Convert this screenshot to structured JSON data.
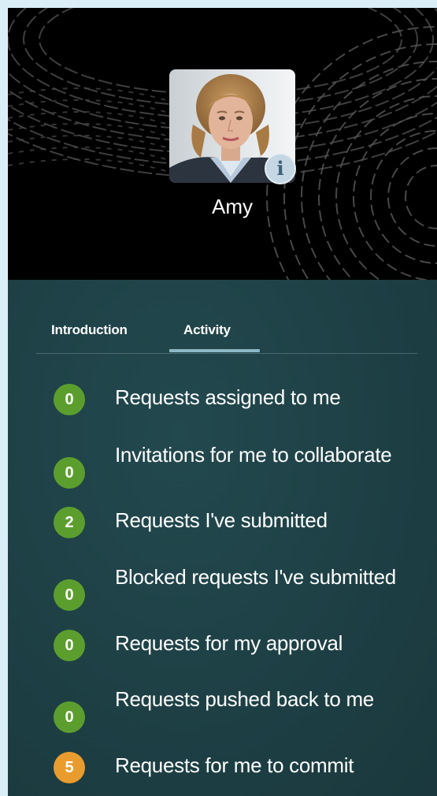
{
  "profile": {
    "name": "Amy",
    "info_icon": "info-icon",
    "avatar": "profile-photo"
  },
  "tabs": [
    {
      "label": "Introduction",
      "selected": false
    },
    {
      "label": "Activity",
      "selected": true
    }
  ],
  "activity": [
    {
      "count": "0",
      "label": "Requests assigned to me",
      "badge_color": "#5c9e2e"
    },
    {
      "count": "0",
      "label": "Invitations for me to collaborate",
      "badge_color": "#5c9e2e"
    },
    {
      "count": "2",
      "label": "Requests I've submitted",
      "badge_color": "#5c9e2e"
    },
    {
      "count": "0",
      "label": "Blocked requests I've submitted",
      "badge_color": "#5c9e2e"
    },
    {
      "count": "0",
      "label": "Requests for my approval",
      "badge_color": "#5c9e2e"
    },
    {
      "count": "0",
      "label": "Requests pushed back to me",
      "badge_color": "#5c9e2e"
    },
    {
      "count": "5",
      "label": "Requests for me to commit",
      "badge_color": "#e99c2e"
    }
  ],
  "colors": {
    "header_bg": "#000000",
    "content_bg": "#1f4247",
    "tab_underline": "#8cb8c6",
    "page_bg": "#daeef8"
  }
}
